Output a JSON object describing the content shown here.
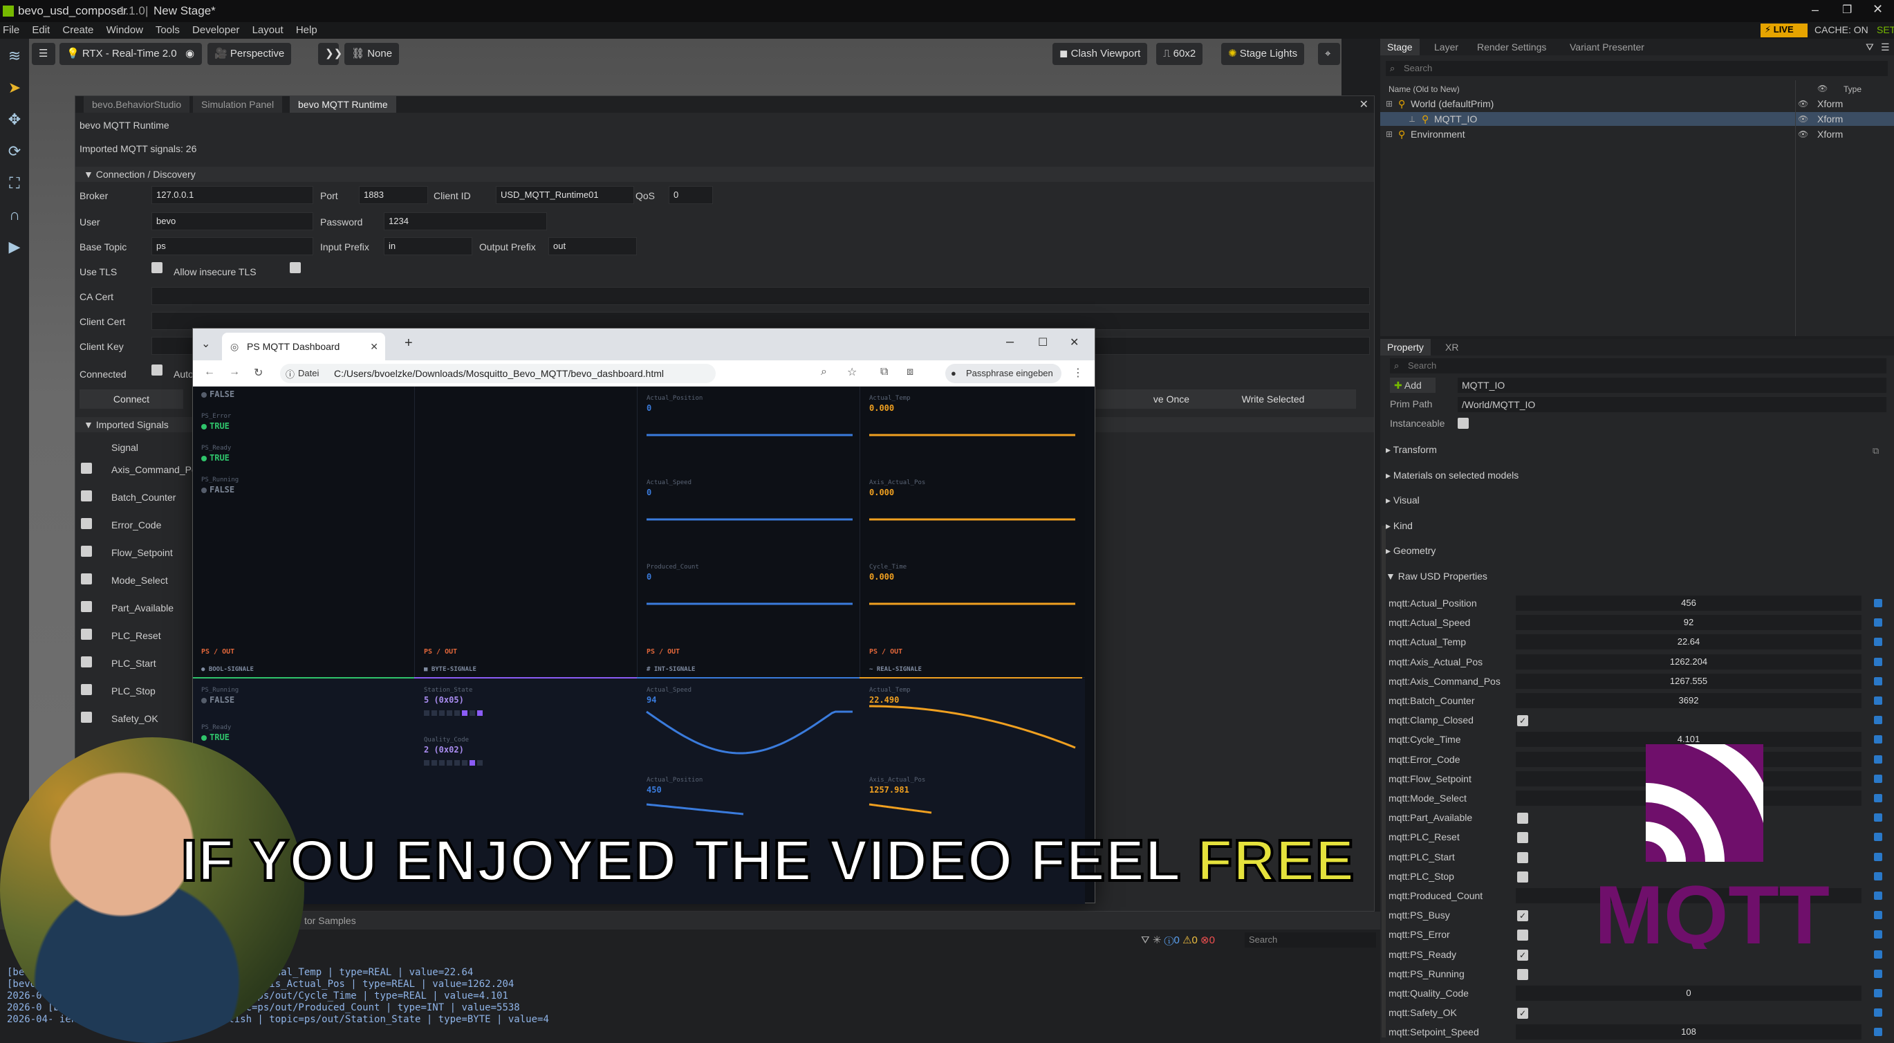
{
  "app": {
    "title": "bevo_usd_composer",
    "version": "1.1.0",
    "stage_name": "New Stage*",
    "live_label": "LIVE",
    "cache_label": "CACHE: ON",
    "set_label": "SET"
  },
  "menu": [
    "File",
    "Edit",
    "Create",
    "Window",
    "Tools",
    "Developer",
    "Layout",
    "Help"
  ],
  "viewport_toolbar": {
    "renderer": "RTX - Real-Time 2.0",
    "camera": "Perspective",
    "none": "None",
    "clash": "Clash Viewport",
    "grid": "60x2",
    "lights": "Stage Lights"
  },
  "runtime": {
    "tabs": [
      "bevo.BehaviorStudio",
      "Simulation Panel",
      "bevo MQTT Runtime"
    ],
    "title": "bevo MQTT Runtime",
    "imported_signals": "Imported MQTT signals: 26",
    "section_connection": "Connection / Discovery",
    "labels": {
      "broker": "Broker",
      "port": "Port",
      "client_id": "Client ID",
      "qos": "QoS",
      "user": "User",
      "password": "Password",
      "base_topic": "Base Topic",
      "input_prefix": "Input Prefix",
      "output_prefix": "Output Prefix",
      "use_tls": "Use TLS",
      "allow_insecure": "Allow insecure TLS",
      "ca_cert": "CA Cert",
      "client_cert": "Client Cert",
      "client_key": "Client Key",
      "connected": "Connected",
      "auto": "Auto"
    },
    "values": {
      "broker": "127.0.0.1",
      "port": "1883",
      "client_id": "USD_MQTT_Runtime01",
      "qos": "0",
      "user": "bevo",
      "password": "1234",
      "base_topic": "ps",
      "input_prefix": "in",
      "output_prefix": "out"
    },
    "buttons": {
      "connect": "Connect",
      "write_once": "ve Once",
      "write_selected": "Write Selected"
    },
    "section_signals": "Imported Signals",
    "signal_header": "Signal",
    "signals": [
      "Axis_Command_Pos",
      "Batch_Counter",
      "Error_Code",
      "Flow_Setpoint",
      "Mode_Select",
      "Part_Available",
      "PLC_Reset",
      "PLC_Start",
      "PLC_Stop",
      "Safety_OK"
    ]
  },
  "browser": {
    "tab_title": "PS MQTT Dashboard",
    "url_chip": "Datei",
    "url": "C:/Users/bvoelzke/Downloads/Mosquitto_Bevo_MQTT/bevo_dashboard.html",
    "profile": "Passphrase eingeben"
  },
  "dashboard": {
    "in_bool": [
      {
        "label": "",
        "value": "FALSE"
      },
      {
        "label": "PS_Error",
        "value": "TRUE"
      },
      {
        "label": "PS_Ready",
        "value": "TRUE"
      },
      {
        "label": "PS_Running",
        "value": "FALSE"
      }
    ],
    "in_int": [
      {
        "label": "Actual_Position",
        "value": "0"
      },
      {
        "label": "Actual_Speed",
        "value": "0"
      },
      {
        "label": "Produced_Count",
        "value": "0"
      }
    ],
    "in_real": [
      {
        "label": "Actual_Temp",
        "value": "0.000"
      },
      {
        "label": "Axis_Actual_Pos",
        "value": "0.000"
      },
      {
        "label": "Cycle_Time",
        "value": "0.000"
      }
    ],
    "out_headers": [
      "PS / OUT",
      "PS / OUT",
      "PS / OUT",
      "PS / OUT"
    ],
    "out_types": [
      "● BOOL-SIGNALE",
      "■ BYTE-SIGNALE",
      "# INT-SIGNALE",
      "~ REAL-SIGNALE"
    ],
    "out_bool": [
      {
        "label": "PS_Running",
        "value": "FALSE"
      },
      {
        "label": "PS_Ready",
        "value": "TRUE"
      }
    ],
    "out_byte": [
      {
        "label": "Station_State",
        "value": "5 (0x05)"
      },
      {
        "label": "Quality_Code",
        "value": "2 (0x02)"
      }
    ],
    "out_int": [
      {
        "label": "Actual_Speed",
        "value": "94"
      },
      {
        "label": "Actual_Position",
        "value": "450"
      }
    ],
    "out_real": [
      {
        "label": "Actual_Temp",
        "value": "22.490"
      },
      {
        "label": "Axis_Actual_Pos",
        "value": "1257.981"
      }
    ],
    "colors": {
      "blue": "#3a7bdc",
      "orange": "#f0a020",
      "green": "#2fc46b",
      "purple": "#8b5cf6"
    }
  },
  "stage": {
    "tabs": [
      "Stage",
      "Layer",
      "Render Settings",
      "Variant Presenter"
    ],
    "search_placeholder": "Search",
    "col_name": "Name (Old to New)",
    "col_type": "Type",
    "rows": [
      {
        "name": "World (defaultPrim)",
        "type": "Xform"
      },
      {
        "name": "MQTT_IO",
        "type": "Xform"
      },
      {
        "name": "Environment",
        "type": "Xform"
      }
    ]
  },
  "property": {
    "tabs": [
      "Property",
      "XR"
    ],
    "search_placeholder": "Search",
    "add_label": "Add",
    "prim_name": "MQTT_IO",
    "prim_path_label": "Prim Path",
    "prim_path": "/World/MQTT_IO",
    "instanceable_label": "Instanceable",
    "sections": [
      "Transform",
      "Materials on selected models",
      "Visual",
      "Kind",
      "Geometry",
      "Raw USD Properties"
    ],
    "props": [
      {
        "name": "mqtt:Actual_Position",
        "value": "456"
      },
      {
        "name": "mqtt:Actual_Speed",
        "value": "92"
      },
      {
        "name": "mqtt:Actual_Temp",
        "value": "22.64"
      },
      {
        "name": "mqtt:Axis_Actual_Pos",
        "value": "1262.204"
      },
      {
        "name": "mqtt:Axis_Command_Pos",
        "value": "1267.555"
      },
      {
        "name": "mqtt:Batch_Counter",
        "value": "3692"
      },
      {
        "name": "mqtt:Clamp_Closed",
        "check": true
      },
      {
        "name": "mqtt:Cycle_Time",
        "value": "4.101"
      },
      {
        "name": "mqtt:Error_Code",
        "value": ""
      },
      {
        "name": "mqtt:Flow_Setpoint",
        "value": ""
      },
      {
        "name": "mqtt:Mode_Select",
        "value": ""
      },
      {
        "name": "mqtt:Part_Available",
        "check": false
      },
      {
        "name": "mqtt:PLC_Reset",
        "check": false
      },
      {
        "name": "mqtt:PLC_Start",
        "check": false
      },
      {
        "name": "mqtt:PLC_Stop",
        "check": false
      },
      {
        "name": "mqtt:Produced_Count",
        "value": ""
      },
      {
        "name": "mqtt:PS_Busy",
        "check": true
      },
      {
        "name": "mqtt:PS_Error",
        "check": false
      },
      {
        "name": "mqtt:PS_Ready",
        "check": true
      },
      {
        "name": "mqtt:PS_Running",
        "check": false
      },
      {
        "name": "mqtt:Quality_Code",
        "value": "0"
      },
      {
        "name": "mqtt:Safety_OK",
        "check": true
      },
      {
        "name": "mqtt:Setpoint_Speed",
        "value": "108"
      }
    ]
  },
  "console": {
    "tab_label": "tor Samples",
    "search_placeholder": "Search",
    "lines": [
      "[bevo MQTT Runtime] publish | topic=ps/out/Actual_Temp | type=REAL | value=22.64",
      "[bevo MQTT Runtime] publish | topic=ps/out/Axis_Actual_Pos | type=REAL | value=1262.204",
      "2026-0  [bevo MQTT Runtime] publish | topic=ps/out/Cycle_Time | type=REAL | value=4.101",
      "2026-0  [bevo MQTT Runtime] publish | topic=ps/out/Produced_Count | type=INT | value=5538",
      "2026-04-  ient] [bevo MQTT Runtime] publish | topic=ps/out/Station_State | type=BYTE | value=4"
    ]
  },
  "overlay": {
    "caption_main": "IF YOU ENJOYED THE VIDEO FEEL ",
    "caption_highlight": "FREE",
    "logo_text": "MQTT"
  }
}
